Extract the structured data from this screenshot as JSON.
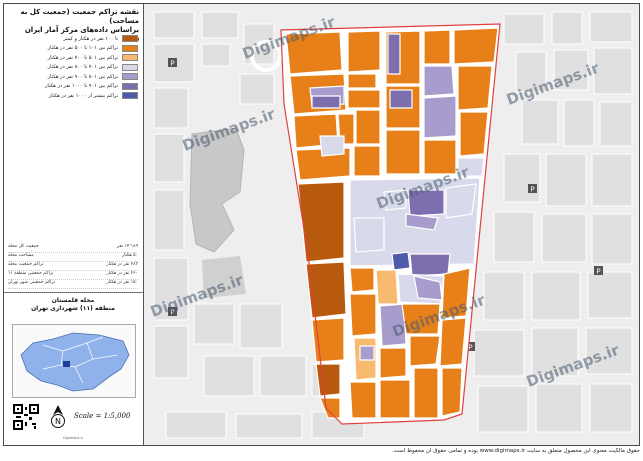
{
  "title_lines": [
    "نقشه تراکم جمعیت (جمعیت کل به مساحت)",
    "براساس داده‌های مرکز آمار ایران ۱۳۹۵"
  ],
  "legend": [
    {
      "label": "تا ۱۰۰ نفر در هکتار و کمتر",
      "color": "#b85a0e"
    },
    {
      "label": "تراکم بین ۱۰۱ تا ۵۰۰ نفر در هکتار",
      "color": "#e8801a"
    },
    {
      "label": "تراکم بین ۵۰۱ تا ۷۰۰ نفر در هکتار",
      "color": "#f7ba6e"
    },
    {
      "label": "تراکم بین ۷۰۱ تا ۸۰۰ نفر در هکتار",
      "color": "#d9d9ec"
    },
    {
      "label": "تراکم بین ۸۰۱ تا ۹۰۰ نفر در هکتار",
      "color": "#a89ccc"
    },
    {
      "label": "تراکم بین ۹۰۱ تا ۱۰۰۰ نفر در هکتار",
      "color": "#7d6fae"
    },
    {
      "label": "تراکم بیشتر از ۱۰۰۰ نفر در هکتار",
      "color": "#4f5aa8"
    }
  ],
  "stats": [
    {
      "label": "جمعیت کل محله",
      "value": "۱۴٬۱۸۹ نفر"
    },
    {
      "label": "مساحت محله",
      "value": "۵۰ هکتار"
    },
    {
      "label": "تراکم جمعیت محله",
      "value": "۲۸۳ نفر در هکتار"
    },
    {
      "label": "تراکم جمعیتی منطقه ۱۱",
      "value": "۲۶۰ نفر در هکتار"
    },
    {
      "label": "تراکم جمعیتی شهر تهران",
      "value": "۱۵۰ نفر در هکتار"
    }
  ],
  "area_title": [
    "محله قلمستان",
    "منطقه (۱۱) شهرداری تهران"
  ],
  "scale": "Scale = 1:5,000",
  "north_label": "N",
  "sidebar_credit": "Digimaps.ir",
  "watermark": "Digimaps.ir",
  "footer": "حقوق مالکیت معنوی این محصول متعلق به سایت www.digimaps.ir بوده و تمامی حقوق آن محفوظ است.",
  "colors": {
    "road": "#ffffff",
    "block_bg": "#e2e2e2",
    "boundary": "#e04040",
    "inset_district": "#8fb2ea"
  }
}
